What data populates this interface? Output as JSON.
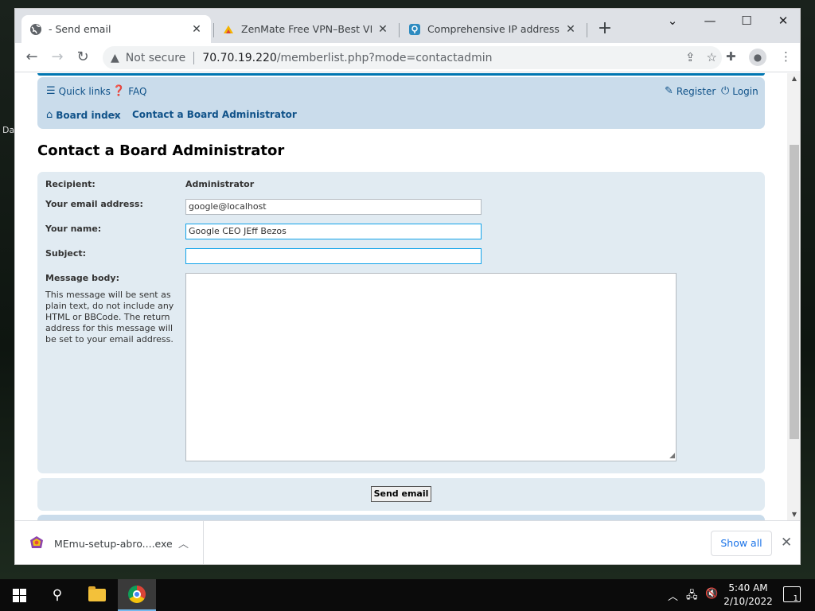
{
  "desktop": {
    "label": "Da"
  },
  "tabs": [
    {
      "title": "- Send email",
      "icon": "globe-icon"
    },
    {
      "title": "ZenMate Free VPN–Best VPN for",
      "icon": "zenmate-icon"
    },
    {
      "title": "Comprehensive IP address data,",
      "icon": "ipinfo-icon"
    }
  ],
  "toolbar": {
    "not_secure": "Not secure",
    "url_host": "70.70.19.220",
    "url_path": "/memberlist.php?mode=contactadmin"
  },
  "forum": {
    "quick_links": "Quick links",
    "faq": "FAQ",
    "register": "Register",
    "login": "Login",
    "breadcrumb_home": "Board index",
    "breadcrumb_current": "Contact a Board Administrator",
    "page_title": "Contact a Board Administrator"
  },
  "form": {
    "recipient_label": "Recipient:",
    "recipient_value": "Administrator",
    "email_label": "Your email address:",
    "email_value": "google@localhost",
    "name_label": "Your name:",
    "name_value": "Google CEO JEff Bezos",
    "subject_label": "Subject:",
    "subject_value": "",
    "body_label": "Message body:",
    "body_explain": "This message will be sent as plain text, do not include any HTML or BBCode. The return address for this message will be set to your email address.",
    "send_label": "Send email"
  },
  "downloads": {
    "file_name": "MEmu-setup-abro....exe",
    "show_all": "Show all"
  },
  "taskbar": {
    "time": "5:40 AM",
    "date": "2/10/2022",
    "notification_count": "1"
  }
}
